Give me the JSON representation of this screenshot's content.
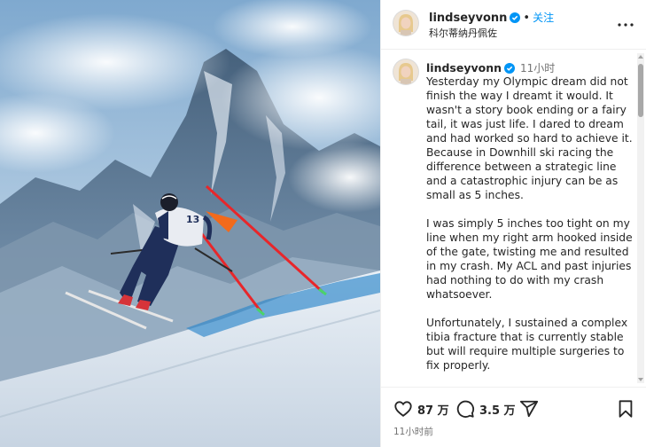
{
  "post": {
    "image_alt_subject": "skier-downhill-photo"
  },
  "header": {
    "username": "lindseyvonn",
    "separator": "•",
    "follow_label": "关注",
    "location": "科尔蒂纳丹佩佐"
  },
  "caption": {
    "username": "lindseyvonn",
    "time": "11小时",
    "paragraphs": [
      "Yesterday my Olympic dream did not finish the way I dreamt it would. It wasn't a story book ending or a fairy tail, it was just life. I dared to dream and had worked so hard to achieve it. Because in Downhill ski racing the difference between a strategic line and a catastrophic injury can be as small as 5 inches.",
      "I was simply 5 inches too tight on my line when my right arm hooked inside of the gate, twisting me and resulted in my crash. My ACL and past injuries had nothing to do with my crash whatsoever.",
      "Unfortunately, I sustained a complex tibia fracture that is currently stable but will require multiple surgeries to fix properly."
    ]
  },
  "actions": {
    "likes": "87 万",
    "comments": "3.5 万",
    "timestamp": "11小时前"
  },
  "bib_number": "13",
  "colors": {
    "accent": "#0095f6",
    "gate_red": "#e8262a",
    "gate_orange": "#f26a1b"
  }
}
